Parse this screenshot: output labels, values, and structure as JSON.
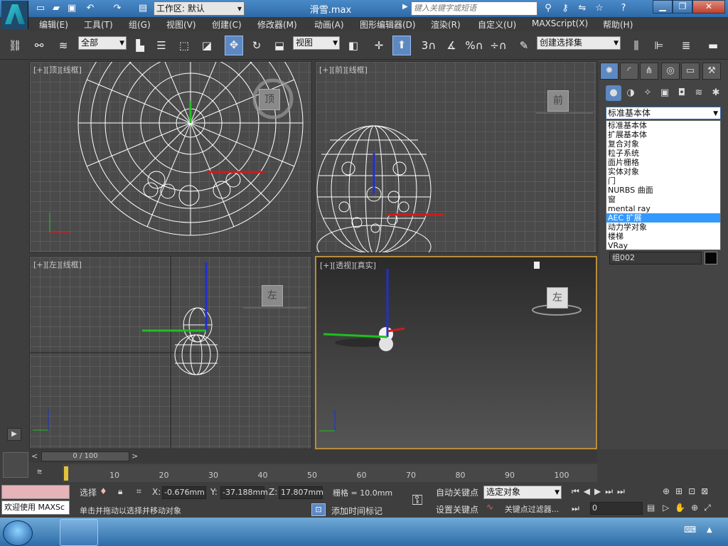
{
  "titlebar": {
    "workspace_label": "工作区: 默认",
    "filename": "滑雪.max",
    "search_placeholder": "键入关键字或短语"
  },
  "menus": [
    "编辑(E)",
    "工具(T)",
    "组(G)",
    "视图(V)",
    "创建(C)",
    "修改器(M)",
    "动画(A)",
    "图形编辑器(D)",
    "渲染(R)",
    "自定义(U)",
    "MAXScript(X)",
    "帮助(H)"
  ],
  "toolbar": {
    "filter_value": "全部",
    "coord_value": "视图",
    "selset_value": "创建选择集",
    "snap_angle": "3",
    "snap_percent": "%"
  },
  "viewports": {
    "top": {
      "label": "[+][顶][线框]",
      "cube": "顶"
    },
    "front": {
      "label": "[+][前][线框]",
      "cube": "前"
    },
    "left": {
      "label": "[+][左][线框]",
      "cube": "左"
    },
    "persp": {
      "label": "[+][透视][真实]",
      "cube": "左"
    }
  },
  "cmdpanel": {
    "category_selected": "标准基本体",
    "options": [
      "标准基本体",
      "扩展基本体",
      "复合对象",
      "粒子系统",
      "面片栅格",
      "实体对象",
      "门",
      "NURBS 曲面",
      "窗",
      "mental ray",
      "AEC 扩展",
      "动力学对象",
      "楼梯",
      "VRay"
    ],
    "highlighted_index": 10,
    "object_name": "组002",
    "object_color": "#050505"
  },
  "timeline": {
    "slider_label": "0 / 100",
    "ticks": [
      "10",
      "20",
      "30",
      "40",
      "50",
      "60",
      "70",
      "80",
      "90",
      "100"
    ]
  },
  "status": {
    "welcome": "欢迎使用 MAXSc",
    "select_label": "选择",
    "x_label": "X:",
    "x_value": "-0.676mm",
    "y_label": "Y:",
    "y_value": "-37.188mm",
    "z_label": "Z:",
    "z_value": "17.807mm",
    "grid": "栅格 = 10.0mm",
    "prompt": "单击并拖动以选择并移动对象",
    "add_time_tag": "添加时间标记",
    "auto_key": "自动关键点",
    "set_key": "设置关键点",
    "key_mode_value": "选定对象",
    "key_filter": "关键点过滤器...",
    "frame_value": "0"
  }
}
